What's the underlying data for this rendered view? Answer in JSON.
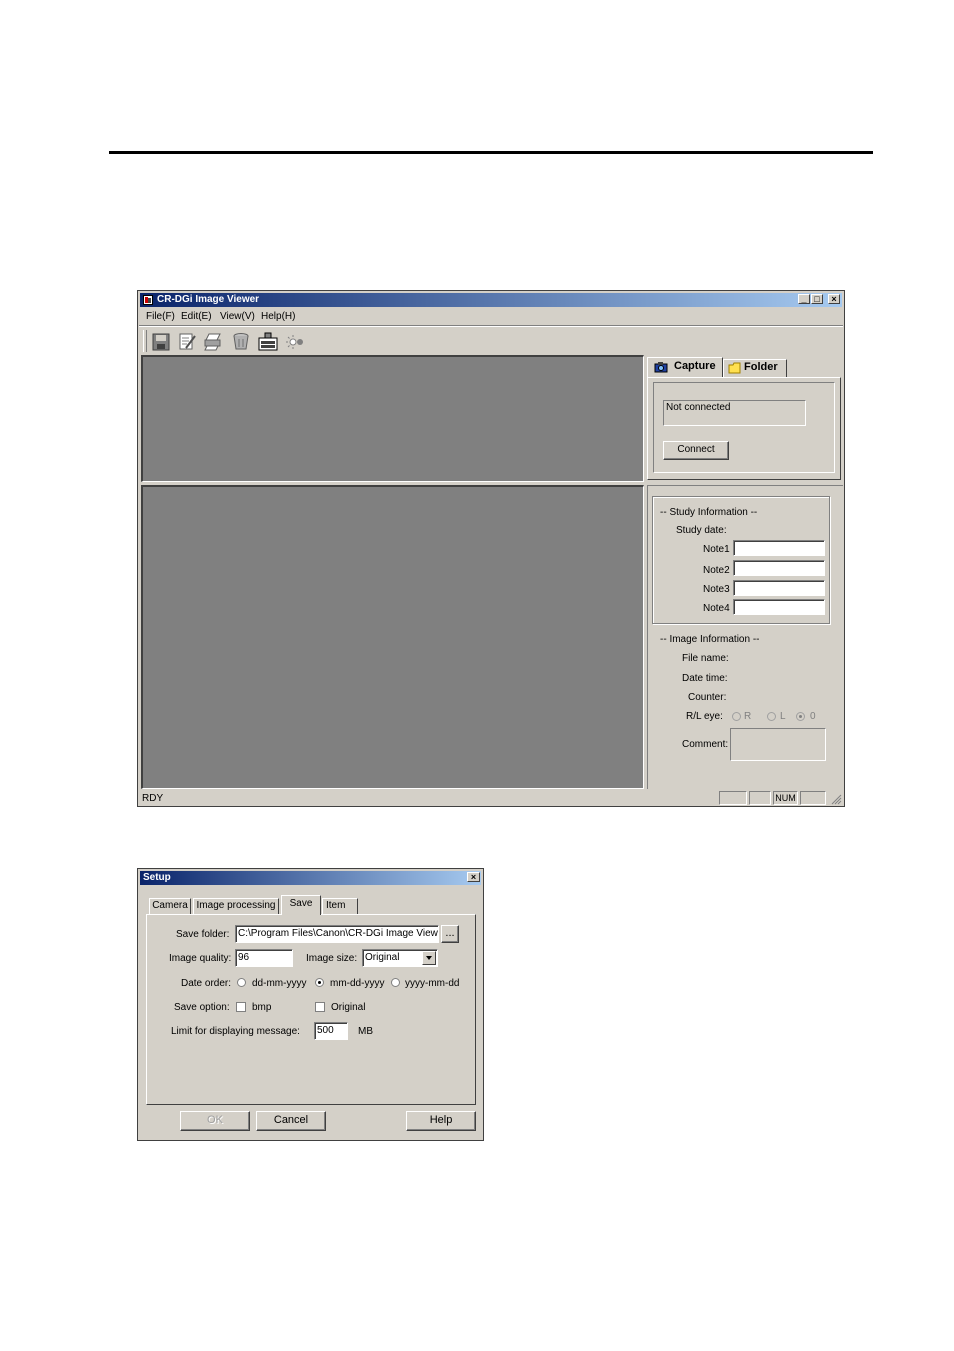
{
  "main_window": {
    "title": "CR-DGi Image Viewer",
    "caption_buttons": {
      "minimize": "_",
      "maximize": "□",
      "close": "×"
    },
    "menu": [
      "File(F)",
      "Edit(E)",
      "View(V)",
      "Help(H)"
    ],
    "toolbar_icons": [
      "save-icon",
      "edit-icon",
      "print-icon",
      "delete-icon",
      "export-icon",
      "brightness-icon"
    ],
    "tabs": {
      "capture": "Capture",
      "folder": "Folder"
    },
    "capture": {
      "status": "Not connected",
      "connect_label": "Connect"
    },
    "study_info": {
      "header": "-- Study Information --",
      "study_date_label": "Study date:",
      "notes": [
        {
          "label": "Note1",
          "value": ""
        },
        {
          "label": "Note2",
          "value": ""
        },
        {
          "label": "Note3",
          "value": ""
        },
        {
          "label": "Note4",
          "value": ""
        }
      ]
    },
    "image_info": {
      "header": "-- Image Information --",
      "file_name_label": "File name:",
      "date_time_label": "Date time:",
      "counter_label": "Counter:",
      "rl_eye_label": "R/L eye:",
      "rl_options": [
        "R",
        "L",
        "0"
      ],
      "rl_selected": "0",
      "comment_label": "Comment:"
    },
    "statusbar": {
      "text": "RDY",
      "num": "NUM"
    }
  },
  "setup_dialog": {
    "title": "Setup",
    "close": "×",
    "tabs": [
      "Camera",
      "Image processing",
      "Save",
      "Item"
    ],
    "active_tab": "Save",
    "save_folder_label": "Save folder:",
    "save_folder_value": "C:\\Program Files\\Canon\\CR-DGi Image View",
    "browse_label": "...",
    "image_quality_label": "Image quality:",
    "image_quality_value": "96",
    "image_size_label": "Image size:",
    "image_size_value": "Original",
    "date_order_label": "Date order:",
    "date_order_options": [
      "dd-mm-yyyy",
      "mm-dd-yyyy",
      "yyyy-mm-dd"
    ],
    "date_order_selected": "mm-dd-yyyy",
    "save_option_label": "Save option:",
    "save_option_bmp": "bmp",
    "save_option_original": "Original",
    "limit_label": "Limit for displaying message:",
    "limit_value": "500",
    "limit_unit": "MB",
    "ok_label": "OK",
    "cancel_label": "Cancel",
    "help_label": "Help"
  }
}
